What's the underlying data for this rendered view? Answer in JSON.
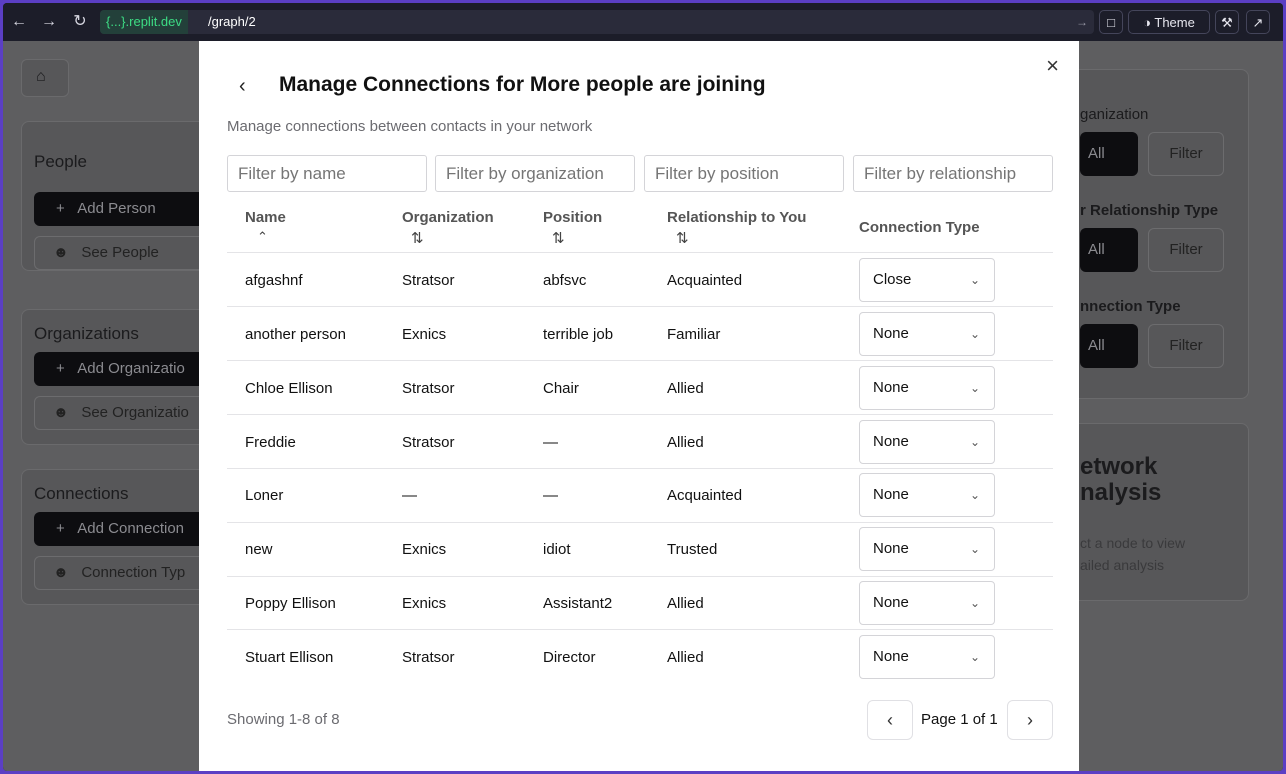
{
  "browser": {
    "host_brace": "{...}",
    "host_domain": ".replit.dev",
    "path": "/graph/2",
    "theme_label": "Theme"
  },
  "background": {
    "people": {
      "title": "People",
      "add_label": "Add Person",
      "see_label": "See People"
    },
    "organizations": {
      "title": "Organizations",
      "add_label": "Add Organizatio",
      "see_label": "See Organizatio"
    },
    "connections": {
      "title": "Connections",
      "add_label": "Add Connection",
      "see_label": "Connection Typ"
    },
    "filters": [
      {
        "label": "ganization",
        "all": "All",
        "filter": "Filter"
      },
      {
        "label": "r Relationship Type",
        "all": "All",
        "filter": "Filter"
      },
      {
        "label": "nnection Type",
        "all": "All",
        "filter": "Filter"
      }
    ],
    "analysis": {
      "title_line1": "etwork",
      "title_line2": "nalysis",
      "hint_line1": "ct a node to view",
      "hint_line2": "ailed analysis"
    }
  },
  "modal": {
    "title": "Manage Connections for More people are joining",
    "subtitle": "Manage connections between contacts in your network",
    "filters": {
      "name": "Filter by name",
      "organization": "Filter by organization",
      "position": "Filter by position",
      "relationship": "Filter by relationship"
    },
    "columns": {
      "name": "Name",
      "organization": "Organization",
      "position": "Position",
      "relationship": "Relationship to You",
      "connection": "Connection Type"
    },
    "rows": [
      {
        "name": "afgashnf",
        "organization": "Stratsor",
        "position": "abfsvc",
        "relationship": "Acquainted",
        "connection": "Close"
      },
      {
        "name": "another person",
        "organization": "Exnics",
        "position": "terrible job",
        "relationship": "Familiar",
        "connection": "None"
      },
      {
        "name": "Chloe Ellison",
        "organization": "Stratsor",
        "position": "Chair",
        "relationship": "Allied",
        "connection": "None"
      },
      {
        "name": "Freddie",
        "organization": "Stratsor",
        "position": "—",
        "relationship": "Allied",
        "connection": "None"
      },
      {
        "name": "Loner",
        "organization": "—",
        "position": "—",
        "relationship": "Acquainted",
        "connection": "None"
      },
      {
        "name": "new",
        "organization": "Exnics",
        "position": "idiot",
        "relationship": "Trusted",
        "connection": "None"
      },
      {
        "name": "Poppy Ellison",
        "organization": "Exnics",
        "position": "Assistant2",
        "relationship": "Allied",
        "connection": "None"
      },
      {
        "name": "Stuart Ellison",
        "organization": "Stratsor",
        "position": "Director",
        "relationship": "Allied",
        "connection": "None"
      }
    ],
    "footer": {
      "showing": "Showing 1-8 of 8",
      "page": "Page 1 of 1"
    }
  }
}
